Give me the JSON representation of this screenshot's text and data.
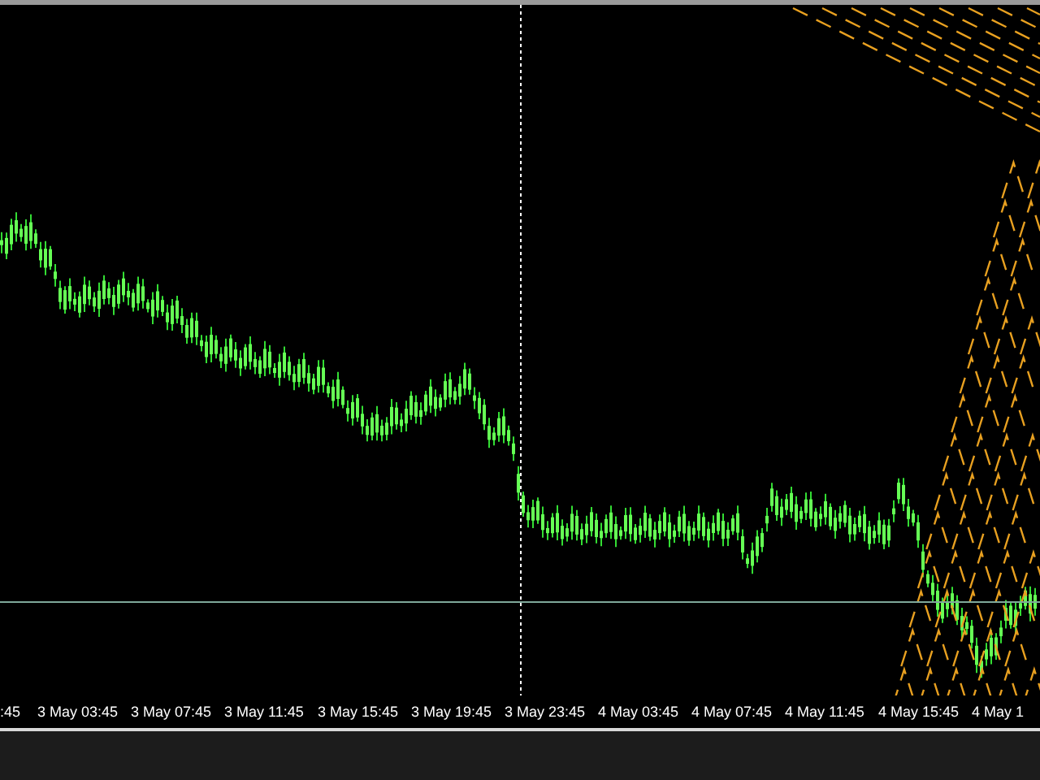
{
  "x_axis": {
    "labels": [
      ":45",
      "3 May 03:45",
      "3 May 07:45",
      "3 May 11:45",
      "3 May 15:45",
      "3 May 19:45",
      "3 May 23:45",
      "4 May 03:45",
      "4 May 07:45",
      "4 May 11:45",
      "4 May 15:45",
      "4 May 1"
    ]
  }
}
